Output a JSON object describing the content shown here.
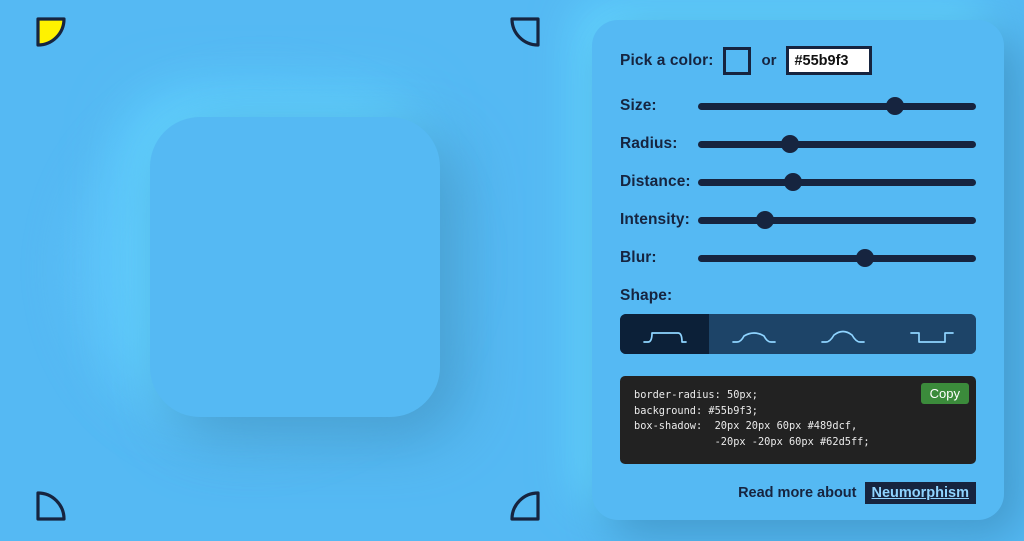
{
  "theme": {
    "page_background": "#55b9f3",
    "ink": "#16243f",
    "shape_selected_bg": "#0c2038",
    "shape_bg": "#1d4468",
    "copy_button_bg": "#3b8b3b",
    "code_bg": "#222222",
    "link_text": "#8fd4ff"
  },
  "preview": {
    "name": "neumorphic-preview-box",
    "background": "#55b9f3",
    "border_radius": "50px",
    "shadow_dark": "#489dcf",
    "shadow_light": "#62d5ff"
  },
  "corners": [
    {
      "name": "corner-ornament-top-left",
      "position": "top-left",
      "filled": true,
      "fill": "#fff200"
    },
    {
      "name": "corner-ornament-top-right",
      "position": "top-right",
      "filled": false,
      "fill": "none"
    },
    {
      "name": "corner-ornament-bottom-left",
      "position": "bottom-left",
      "filled": false,
      "fill": "none"
    },
    {
      "name": "corner-ornament-bottom-right",
      "position": "bottom-right",
      "filled": false,
      "fill": "none"
    }
  ],
  "panel": {
    "color_row": {
      "label": "Pick a color:",
      "or_text": "or",
      "swatch_value": "#55b9f3",
      "hex_value": "#55b9f3",
      "hex_placeholder": "#55b9f3"
    },
    "sliders": [
      {
        "name": "size",
        "label": "Size:",
        "percent": 71
      },
      {
        "name": "radius",
        "label": "Radius:",
        "percent": 33
      },
      {
        "name": "distance",
        "label": "Distance:",
        "percent": 34
      },
      {
        "name": "intensity",
        "label": "Intensity:",
        "percent": 24
      },
      {
        "name": "blur",
        "label": "Blur:",
        "percent": 60
      }
    ],
    "shape": {
      "label": "Shape:",
      "selected_index": 0,
      "options": [
        {
          "name": "shape-flat",
          "icon": "profile-flat-icon",
          "selected": true
        },
        {
          "name": "shape-concave",
          "icon": "profile-concave-icon",
          "selected": false
        },
        {
          "name": "shape-convex",
          "icon": "profile-convex-icon",
          "selected": false
        },
        {
          "name": "shape-pressed",
          "icon": "profile-pressed-icon",
          "selected": false
        }
      ]
    },
    "code": {
      "text": "border-radius: 50px;\nbackground: #55b9f3;\nbox-shadow:  20px 20px 60px #489dcf,\n             -20px -20px 60px #62d5ff;",
      "copy_label": "Copy"
    },
    "footer": {
      "text": "Read more about",
      "link_label": "Neumorphism"
    }
  }
}
